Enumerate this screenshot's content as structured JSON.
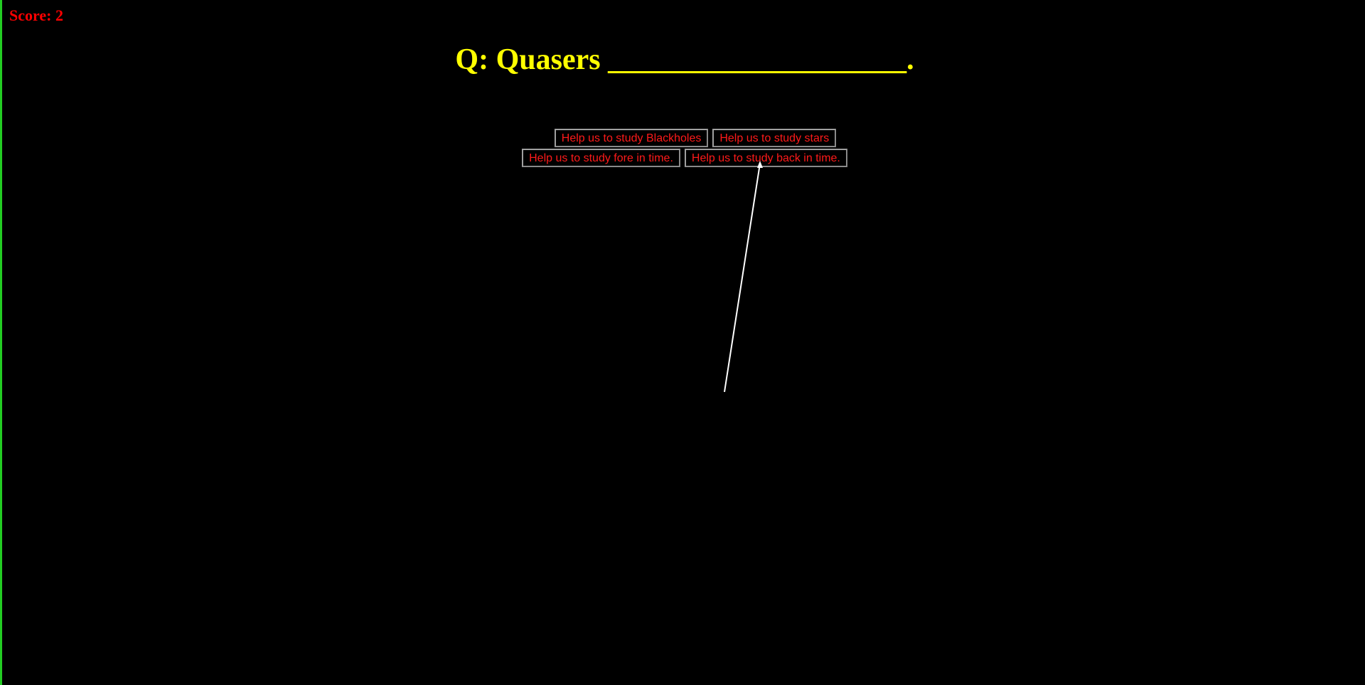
{
  "score": {
    "label": "Score: 2"
  },
  "question": {
    "text": "Q: Quasers ____________________."
  },
  "answers": [
    {
      "label": "Help us to study Blackholes"
    },
    {
      "label": "Help us to study stars"
    },
    {
      "label": "Help us to study fore in time."
    },
    {
      "label": "Help us to study back in time."
    }
  ],
  "colors": {
    "background": "#000000",
    "border_accent": "#22cc22",
    "score": "#ff0000",
    "question": "#ffff00",
    "answer_text": "#ff1a1a",
    "pointer_line": "#ffffff"
  },
  "icons": {
    "pointer": "aim-line-arrow-icon"
  }
}
